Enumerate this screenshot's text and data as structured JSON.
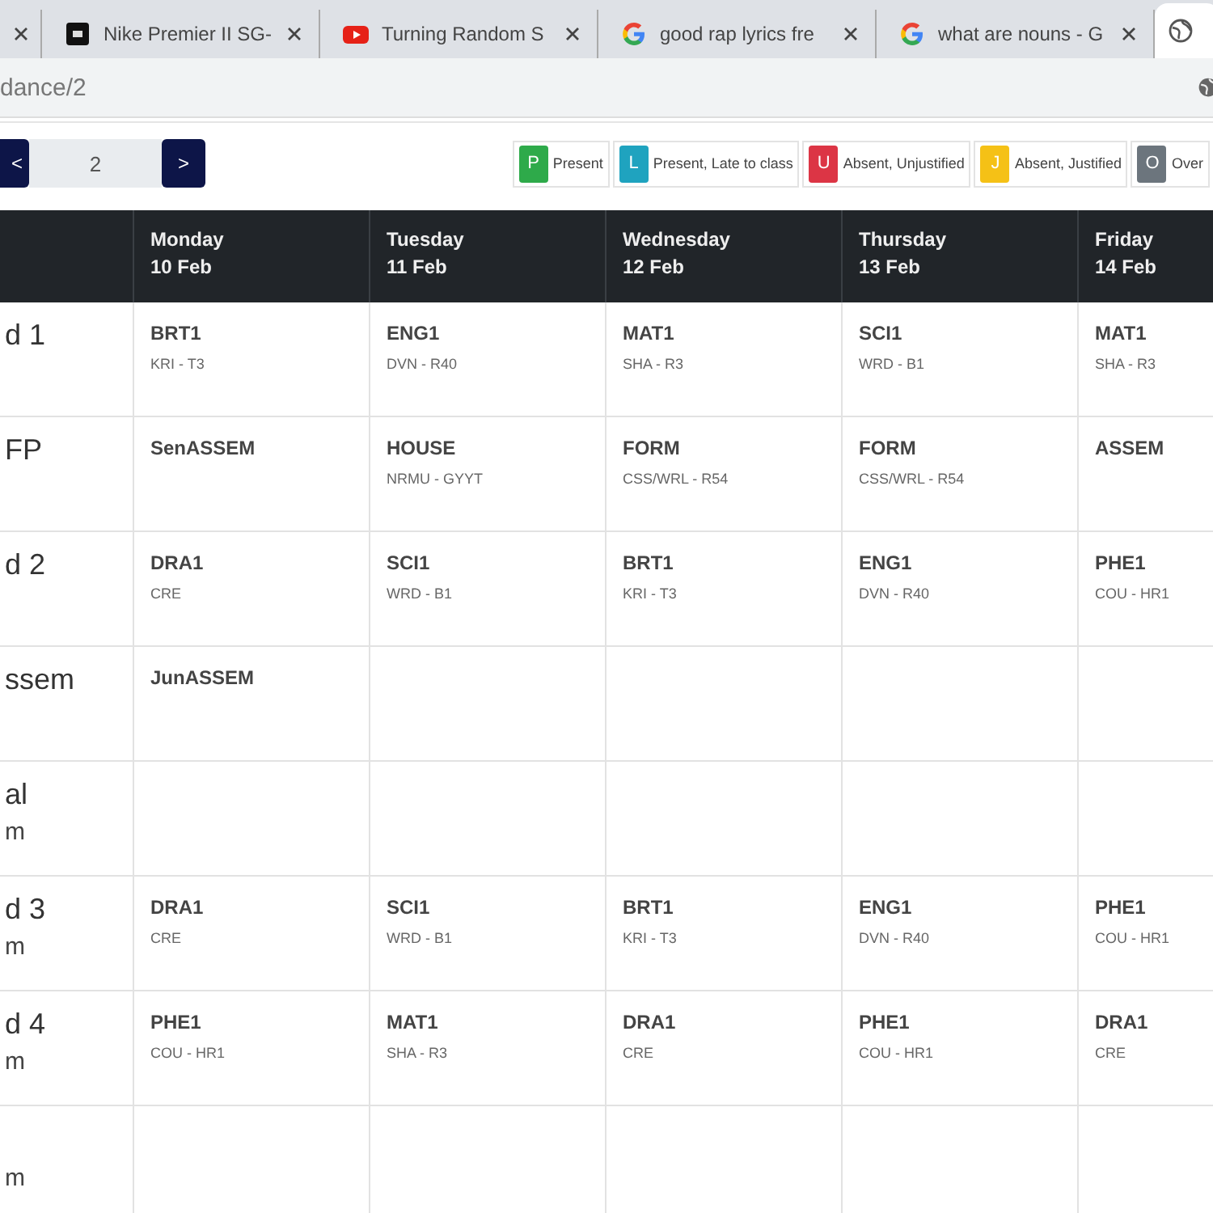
{
  "tabs": [
    {
      "kind": "none",
      "selected": false
    },
    {
      "kind": "square",
      "title": "Nike Premier II SG-",
      "selected": false
    },
    {
      "kind": "play",
      "title": "Turning Random S",
      "selected": false
    },
    {
      "kind": "g",
      "title": "good rap lyrics fre",
      "selected": false
    },
    {
      "kind": "g",
      "title": "what are nouns - G",
      "selected": false
    },
    {
      "kind": "globe",
      "selected": true
    }
  ],
  "address_bar": {
    "url": "dance/2"
  },
  "week_nav": {
    "prev": "<",
    "value": "2",
    "next": ">"
  },
  "legend": [
    {
      "code": "P",
      "label": "Present",
      "color": "#2eaa4a"
    },
    {
      "code": "L",
      "label": "Present, Late to class",
      "color": "#1fa3bf"
    },
    {
      "code": "U",
      "label": "Absent, Unjustified",
      "color": "#dc3545"
    },
    {
      "code": "J",
      "label": "Absent, Justified",
      "color": "#f5c116"
    },
    {
      "code": "O",
      "label": "Over",
      "color": "#6c757d"
    }
  ],
  "table": {
    "columns": [
      {
        "day": "Monday",
        "date": "10 Feb"
      },
      {
        "day": "Tuesday",
        "date": "11 Feb"
      },
      {
        "day": "Wednesday",
        "date": "12 Feb"
      },
      {
        "day": "Thursday",
        "date": "13 Feb"
      },
      {
        "day": "Friday",
        "date": "14 Feb"
      }
    ],
    "rows": [
      {
        "period": "d 1",
        "cells": [
          {
            "subject": "BRT1",
            "detail": "KRI - T3"
          },
          {
            "subject": "ENG1",
            "detail": "DVN - R40"
          },
          {
            "subject": "MAT1",
            "detail": "SHA - R3"
          },
          {
            "subject": "SCI1",
            "detail": "WRD - B1"
          },
          {
            "subject": "MAT1",
            "detail": "SHA - R3"
          }
        ]
      },
      {
        "period": "FP",
        "cells": [
          {
            "subject": "SenASSEM"
          },
          {
            "subject": "HOUSE",
            "detail": "NRMU - GYYT"
          },
          {
            "subject": "FORM",
            "detail": "CSS/WRL - R54"
          },
          {
            "subject": "FORM",
            "detail": "CSS/WRL - R54"
          },
          {
            "subject": "ASSEM"
          }
        ]
      },
      {
        "period": "d 2",
        "cells": [
          {
            "subject": "DRA1",
            "detail": "CRE"
          },
          {
            "subject": "SCI1",
            "detail": "WRD - B1"
          },
          {
            "subject": "BRT1",
            "detail": "KRI - T3"
          },
          {
            "subject": "ENG1",
            "detail": "DVN - R40"
          },
          {
            "subject": "PHE1",
            "detail": "COU - HR1"
          }
        ]
      },
      {
        "period": "ssem",
        "cells": [
          {
            "subject": "JunASSEM"
          },
          {},
          {},
          {},
          {}
        ]
      },
      {
        "period": "al",
        "time": "m",
        "cells": [
          {},
          {},
          {},
          {},
          {}
        ]
      },
      {
        "period": "d 3",
        "time": "m",
        "cells": [
          {
            "subject": "DRA1",
            "detail": "CRE"
          },
          {
            "subject": "SCI1",
            "detail": "WRD - B1"
          },
          {
            "subject": "BRT1",
            "detail": "KRI - T3"
          },
          {
            "subject": "ENG1",
            "detail": "DVN - R40"
          },
          {
            "subject": "PHE1",
            "detail": "COU - HR1"
          }
        ]
      },
      {
        "period": "d 4",
        "time": "m",
        "cells": [
          {
            "subject": "PHE1",
            "detail": "COU - HR1"
          },
          {
            "subject": "MAT1",
            "detail": "SHA - R3"
          },
          {
            "subject": "DRA1",
            "detail": "CRE"
          },
          {
            "subject": "PHE1",
            "detail": "COU - HR1"
          },
          {
            "subject": "DRA1",
            "detail": "CRE"
          }
        ]
      },
      {
        "time": "m",
        "cells": [
          {},
          {},
          {},
          {},
          {}
        ]
      }
    ]
  }
}
